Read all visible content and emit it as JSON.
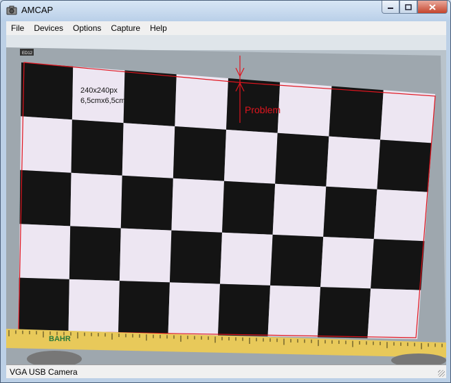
{
  "window": {
    "title": "AMCAP"
  },
  "menu": {
    "items": [
      "File",
      "Devices",
      "Options",
      "Capture",
      "Help"
    ]
  },
  "video": {
    "label_size": "240x240px",
    "label_dims": "6,5cmx6,5cm",
    "annotation": "Problem",
    "ruler_brand": "BAHR",
    "monitor_badge": "ED12"
  },
  "status": {
    "text": "VGA USB Camera"
  },
  "colors": {
    "annotation": "#e0141e",
    "checker_light": "#ede6f2",
    "checker_dark": "#141414"
  }
}
